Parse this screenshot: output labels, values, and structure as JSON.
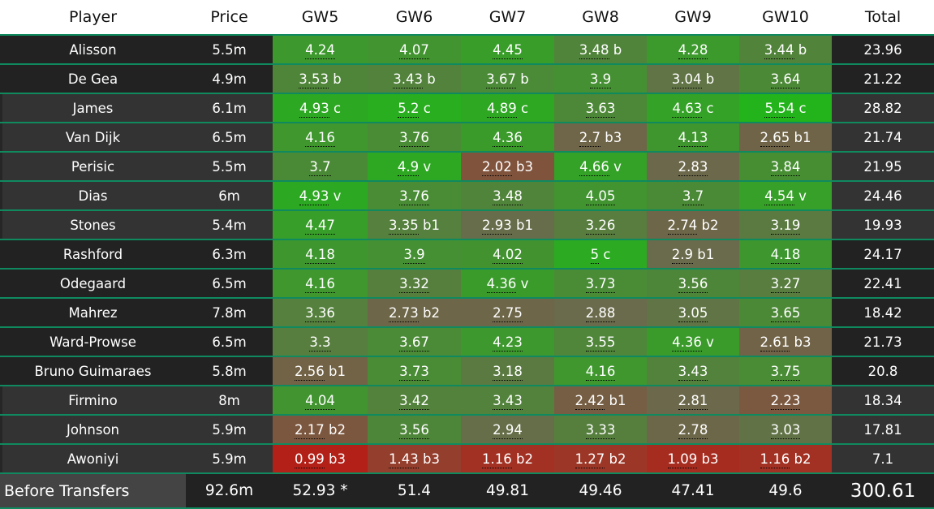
{
  "headers": [
    "Player",
    "Price",
    "GW5",
    "GW6",
    "GW7",
    "GW8",
    "GW9",
    "GW10",
    "Total"
  ],
  "rows": [
    {
      "player": "Alisson",
      "price": "5.5m",
      "gws": [
        [
          "4.24",
          ""
        ],
        [
          "4.07",
          ""
        ],
        [
          "4.45",
          ""
        ],
        [
          "3.48",
          "b"
        ],
        [
          "4.28",
          ""
        ],
        [
          "3.44",
          "b"
        ]
      ],
      "total": "23.96"
    },
    {
      "player": "De Gea",
      "price": "4.9m",
      "gws": [
        [
          "3.53",
          "b"
        ],
        [
          "3.43",
          "b"
        ],
        [
          "3.67",
          "b"
        ],
        [
          "3.9",
          ""
        ],
        [
          "3.04",
          "b"
        ],
        [
          "3.64",
          ""
        ]
      ],
      "total": "21.22"
    },
    {
      "player": "James",
      "price": "6.1m",
      "gws": [
        [
          "4.93",
          "c"
        ],
        [
          "5.2",
          "c"
        ],
        [
          "4.89",
          "c"
        ],
        [
          "3.63",
          ""
        ],
        [
          "4.63",
          "c"
        ],
        [
          "5.54",
          "c"
        ]
      ],
      "total": "28.82"
    },
    {
      "player": "Van Dijk",
      "price": "6.5m",
      "gws": [
        [
          "4.16",
          ""
        ],
        [
          "3.76",
          ""
        ],
        [
          "4.36",
          ""
        ],
        [
          "2.7",
          "b3"
        ],
        [
          "4.13",
          ""
        ],
        [
          "2.65",
          "b1"
        ]
      ],
      "total": "21.74"
    },
    {
      "player": "Perisic",
      "price": "5.5m",
      "gws": [
        [
          "3.7",
          ""
        ],
        [
          "4.9",
          "v"
        ],
        [
          "2.02",
          "b3"
        ],
        [
          "4.66",
          "v"
        ],
        [
          "2.83",
          ""
        ],
        [
          "3.84",
          ""
        ]
      ],
      "total": "21.95"
    },
    {
      "player": "Dias",
      "price": "6m",
      "gws": [
        [
          "4.93",
          "v"
        ],
        [
          "3.76",
          ""
        ],
        [
          "3.48",
          ""
        ],
        [
          "4.05",
          ""
        ],
        [
          "3.7",
          ""
        ],
        [
          "4.54",
          "v"
        ]
      ],
      "total": "24.46"
    },
    {
      "player": "Stones",
      "price": "5.4m",
      "gws": [
        [
          "4.47",
          ""
        ],
        [
          "3.35",
          "b1"
        ],
        [
          "2.93",
          "b1"
        ],
        [
          "3.26",
          ""
        ],
        [
          "2.74",
          "b2"
        ],
        [
          "3.19",
          ""
        ]
      ],
      "total": "19.93"
    },
    {
      "player": "Rashford",
      "price": "6.3m",
      "gws": [
        [
          "4.18",
          ""
        ],
        [
          "3.9",
          ""
        ],
        [
          "4.02",
          ""
        ],
        [
          "5",
          "c"
        ],
        [
          "2.9",
          "b1"
        ],
        [
          "4.18",
          ""
        ]
      ],
      "total": "24.17"
    },
    {
      "player": "Odegaard",
      "price": "6.5m",
      "gws": [
        [
          "4.16",
          ""
        ],
        [
          "3.32",
          ""
        ],
        [
          "4.36",
          "v"
        ],
        [
          "3.73",
          ""
        ],
        [
          "3.56",
          ""
        ],
        [
          "3.27",
          ""
        ]
      ],
      "total": "22.41"
    },
    {
      "player": "Mahrez",
      "price": "7.8m",
      "gws": [
        [
          "3.36",
          ""
        ],
        [
          "2.73",
          "b2"
        ],
        [
          "2.75",
          ""
        ],
        [
          "2.88",
          ""
        ],
        [
          "3.05",
          ""
        ],
        [
          "3.65",
          ""
        ]
      ],
      "total": "18.42"
    },
    {
      "player": "Ward-Prowse",
      "price": "6.5m",
      "gws": [
        [
          "3.3",
          ""
        ],
        [
          "3.67",
          ""
        ],
        [
          "4.23",
          ""
        ],
        [
          "3.55",
          ""
        ],
        [
          "4.36",
          "v"
        ],
        [
          "2.61",
          "b3"
        ]
      ],
      "total": "21.73"
    },
    {
      "player": "Bruno Guimaraes",
      "price": "5.8m",
      "gws": [
        [
          "2.56",
          "b1"
        ],
        [
          "3.73",
          ""
        ],
        [
          "3.18",
          ""
        ],
        [
          "4.16",
          ""
        ],
        [
          "3.43",
          ""
        ],
        [
          "3.75",
          ""
        ]
      ],
      "total": "20.8"
    },
    {
      "player": "Firmino",
      "price": "8m",
      "gws": [
        [
          "4.04",
          ""
        ],
        [
          "3.42",
          ""
        ],
        [
          "3.43",
          ""
        ],
        [
          "2.42",
          "b1"
        ],
        [
          "2.81",
          ""
        ],
        [
          "2.23",
          ""
        ]
      ],
      "total": "18.34"
    },
    {
      "player": "Johnson",
      "price": "5.9m",
      "gws": [
        [
          "2.17",
          "b2"
        ],
        [
          "3.56",
          ""
        ],
        [
          "2.94",
          ""
        ],
        [
          "3.33",
          ""
        ],
        [
          "2.78",
          ""
        ],
        [
          "3.03",
          ""
        ]
      ],
      "total": "17.81"
    },
    {
      "player": "Awoniyi",
      "price": "5.9m",
      "gws": [
        [
          "0.99",
          "b3"
        ],
        [
          "1.43",
          "b3"
        ],
        [
          "1.16",
          "b2"
        ],
        [
          "1.27",
          "b2"
        ],
        [
          "1.09",
          "b3"
        ],
        [
          "1.16",
          "b2"
        ]
      ],
      "total": "7.1"
    }
  ],
  "footer": {
    "label": "Before Transfers",
    "price": "92.6m",
    "gws": [
      "52.93 *",
      "51.4",
      "49.81",
      "49.46",
      "47.41",
      "49.6"
    ],
    "total": "300.61"
  },
  "colors": {
    "low": "#b22018",
    "mid": "#6a6a4c",
    "high": "#22b41a",
    "border": "#0f8a5f"
  }
}
